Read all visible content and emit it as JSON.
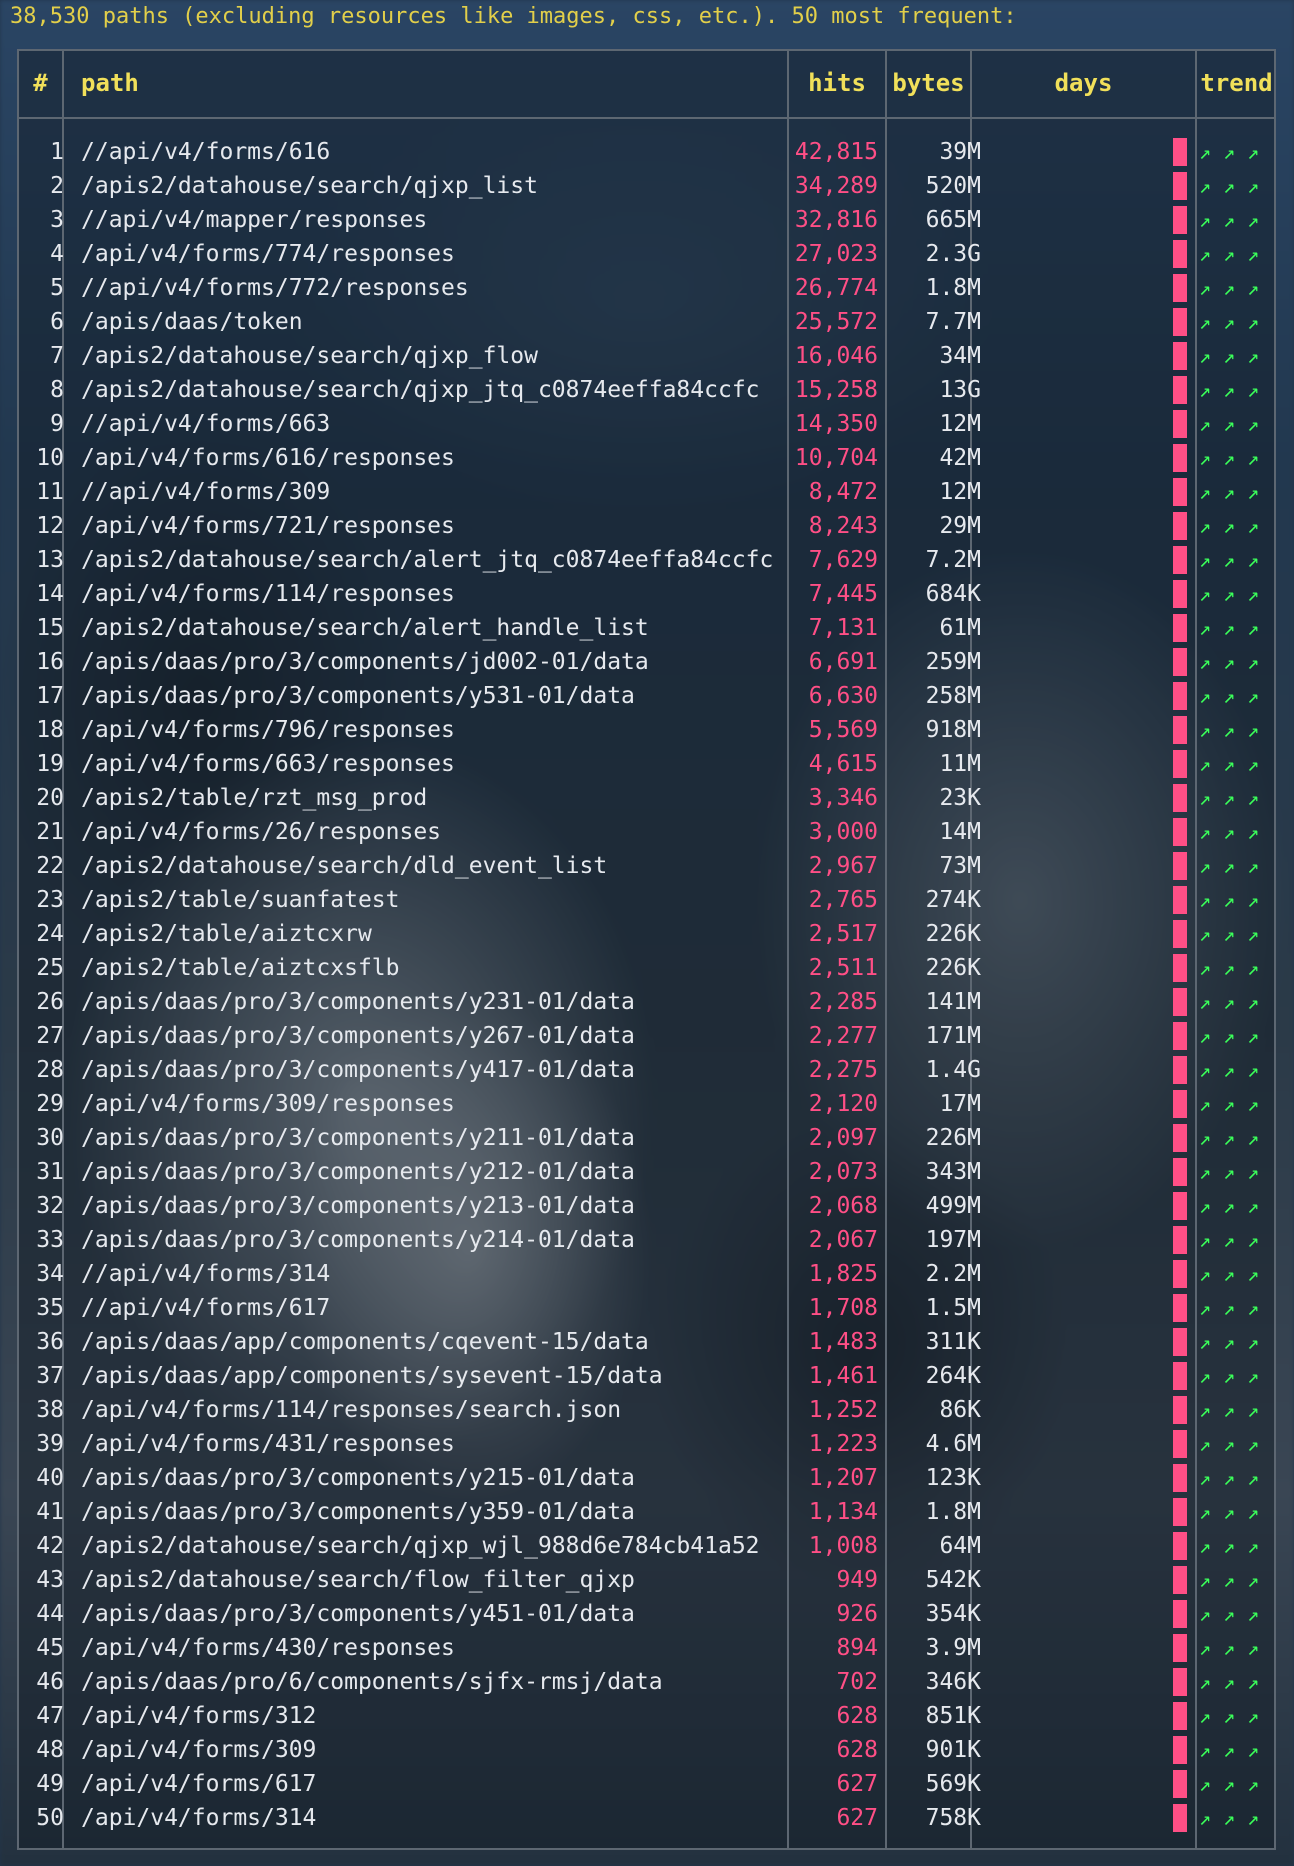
{
  "summary": "38,530 paths (excluding resources like images, css, etc.). 50 most frequent:",
  "columns": {
    "num": "#",
    "path": "path",
    "hits": "hits",
    "bytes": "bytes",
    "days": "days",
    "trend": "trend"
  },
  "trend_glyph": "↗ ↗ ↗",
  "colors": {
    "header_text": "#e2cf4a",
    "column_header": "#f1e05a",
    "hits": "#ff4f86",
    "bar": "#ff4f86",
    "trend": "#3bff5a",
    "border": "#5d6772"
  },
  "rows": [
    {
      "n": "1",
      "path": "//api/v4/forms/616",
      "hits": "42,815",
      "bytes": "39M"
    },
    {
      "n": "2",
      "path": "/apis2/datahouse/search/qjxp_list",
      "hits": "34,289",
      "bytes": "520M"
    },
    {
      "n": "3",
      "path": "//api/v4/mapper/responses",
      "hits": "32,816",
      "bytes": "665M"
    },
    {
      "n": "4",
      "path": "/api/v4/forms/774/responses",
      "hits": "27,023",
      "bytes": "2.3G"
    },
    {
      "n": "5",
      "path": "//api/v4/forms/772/responses",
      "hits": "26,774",
      "bytes": "1.8M"
    },
    {
      "n": "6",
      "path": "/apis/daas/token",
      "hits": "25,572",
      "bytes": "7.7M"
    },
    {
      "n": "7",
      "path": "/apis2/datahouse/search/qjxp_flow",
      "hits": "16,046",
      "bytes": "34M"
    },
    {
      "n": "8",
      "path": "/apis2/datahouse/search/qjxp_jtq_c0874eeffa84ccfc",
      "hits": "15,258",
      "bytes": "13G"
    },
    {
      "n": "9",
      "path": "//api/v4/forms/663",
      "hits": "14,350",
      "bytes": "12M"
    },
    {
      "n": "10",
      "path": "/api/v4/forms/616/responses",
      "hits": "10,704",
      "bytes": "42M"
    },
    {
      "n": "11",
      "path": "//api/v4/forms/309",
      "hits": "8,472",
      "bytes": "12M"
    },
    {
      "n": "12",
      "path": "/api/v4/forms/721/responses",
      "hits": "8,243",
      "bytes": "29M"
    },
    {
      "n": "13",
      "path": "/apis2/datahouse/search/alert_jtq_c0874eeffa84ccfc",
      "hits": "7,629",
      "bytes": "7.2M"
    },
    {
      "n": "14",
      "path": "/api/v4/forms/114/responses",
      "hits": "7,445",
      "bytes": "684K"
    },
    {
      "n": "15",
      "path": "/apis2/datahouse/search/alert_handle_list",
      "hits": "7,131",
      "bytes": "61M"
    },
    {
      "n": "16",
      "path": "/apis/daas/pro/3/components/jd002-01/data",
      "hits": "6,691",
      "bytes": "259M"
    },
    {
      "n": "17",
      "path": "/apis/daas/pro/3/components/y531-01/data",
      "hits": "6,630",
      "bytes": "258M"
    },
    {
      "n": "18",
      "path": "/api/v4/forms/796/responses",
      "hits": "5,569",
      "bytes": "918M"
    },
    {
      "n": "19",
      "path": "/api/v4/forms/663/responses",
      "hits": "4,615",
      "bytes": "11M"
    },
    {
      "n": "20",
      "path": "/apis2/table/rzt_msg_prod",
      "hits": "3,346",
      "bytes": "23K"
    },
    {
      "n": "21",
      "path": "/api/v4/forms/26/responses",
      "hits": "3,000",
      "bytes": "14M"
    },
    {
      "n": "22",
      "path": "/apis2/datahouse/search/dld_event_list",
      "hits": "2,967",
      "bytes": "73M"
    },
    {
      "n": "23",
      "path": "/apis2/table/suanfatest",
      "hits": "2,765",
      "bytes": "274K"
    },
    {
      "n": "24",
      "path": "/apis2/table/aiztcxrw",
      "hits": "2,517",
      "bytes": "226K"
    },
    {
      "n": "25",
      "path": "/apis2/table/aiztcxsflb",
      "hits": "2,511",
      "bytes": "226K"
    },
    {
      "n": "26",
      "path": "/apis/daas/pro/3/components/y231-01/data",
      "hits": "2,285",
      "bytes": "141M"
    },
    {
      "n": "27",
      "path": "/apis/daas/pro/3/components/y267-01/data",
      "hits": "2,277",
      "bytes": "171M"
    },
    {
      "n": "28",
      "path": "/apis/daas/pro/3/components/y417-01/data",
      "hits": "2,275",
      "bytes": "1.4G"
    },
    {
      "n": "29",
      "path": "/api/v4/forms/309/responses",
      "hits": "2,120",
      "bytes": "17M"
    },
    {
      "n": "30",
      "path": "/apis/daas/pro/3/components/y211-01/data",
      "hits": "2,097",
      "bytes": "226M"
    },
    {
      "n": "31",
      "path": "/apis/daas/pro/3/components/y212-01/data",
      "hits": "2,073",
      "bytes": "343M"
    },
    {
      "n": "32",
      "path": "/apis/daas/pro/3/components/y213-01/data",
      "hits": "2,068",
      "bytes": "499M"
    },
    {
      "n": "33",
      "path": "/apis/daas/pro/3/components/y214-01/data",
      "hits": "2,067",
      "bytes": "197M"
    },
    {
      "n": "34",
      "path": "//api/v4/forms/314",
      "hits": "1,825",
      "bytes": "2.2M"
    },
    {
      "n": "35",
      "path": "//api/v4/forms/617",
      "hits": "1,708",
      "bytes": "1.5M"
    },
    {
      "n": "36",
      "path": "/apis/daas/app/components/cqevent-15/data",
      "hits": "1,483",
      "bytes": "311K"
    },
    {
      "n": "37",
      "path": "/apis/daas/app/components/sysevent-15/data",
      "hits": "1,461",
      "bytes": "264K"
    },
    {
      "n": "38",
      "path": "/api/v4/forms/114/responses/search.json",
      "hits": "1,252",
      "bytes": "86K"
    },
    {
      "n": "39",
      "path": "/api/v4/forms/431/responses",
      "hits": "1,223",
      "bytes": "4.6M"
    },
    {
      "n": "40",
      "path": "/apis/daas/pro/3/components/y215-01/data",
      "hits": "1,207",
      "bytes": "123K"
    },
    {
      "n": "41",
      "path": "/apis/daas/pro/3/components/y359-01/data",
      "hits": "1,134",
      "bytes": "1.8M"
    },
    {
      "n": "42",
      "path": "/apis2/datahouse/search/qjxp_wjl_988d6e784cb41a52",
      "hits": "1,008",
      "bytes": "64M"
    },
    {
      "n": "43",
      "path": "/apis2/datahouse/search/flow_filter_qjxp",
      "hits": "949",
      "bytes": "542K"
    },
    {
      "n": "44",
      "path": "/apis/daas/pro/3/components/y451-01/data",
      "hits": "926",
      "bytes": "354K"
    },
    {
      "n": "45",
      "path": "/api/v4/forms/430/responses",
      "hits": "894",
      "bytes": "3.9M"
    },
    {
      "n": "46",
      "path": "/apis/daas/pro/6/components/sjfx-rmsj/data",
      "hits": "702",
      "bytes": "346K"
    },
    {
      "n": "47",
      "path": "/api/v4/forms/312",
      "hits": "628",
      "bytes": "851K"
    },
    {
      "n": "48",
      "path": "/api/v4/forms/309",
      "hits": "628",
      "bytes": "901K"
    },
    {
      "n": "49",
      "path": "/api/v4/forms/617",
      "hits": "627",
      "bytes": "569K"
    },
    {
      "n": "50",
      "path": "/api/v4/forms/314",
      "hits": "627",
      "bytes": "758K"
    }
  ]
}
